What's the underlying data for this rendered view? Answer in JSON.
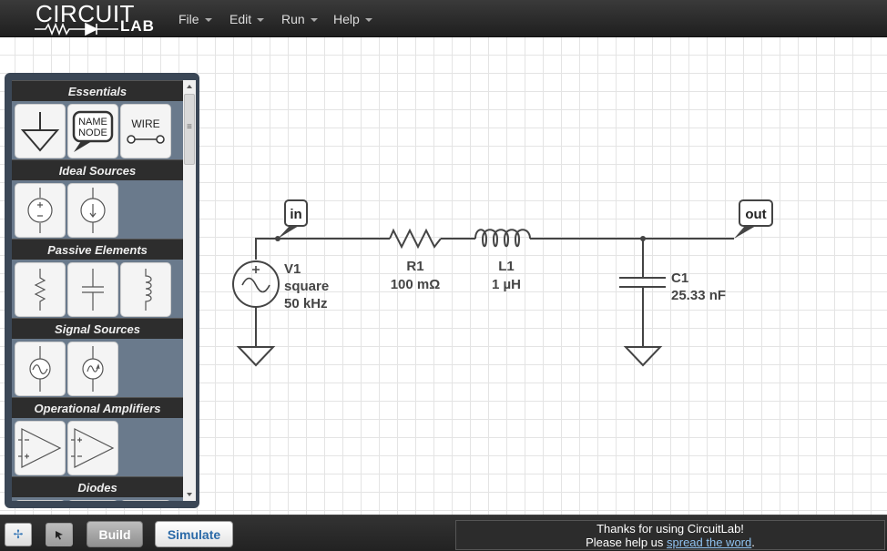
{
  "header": {
    "logo_top": "CIRCUIT",
    "logo_bottom": "LAB",
    "menus": [
      {
        "label": "File"
      },
      {
        "label": "Edit"
      },
      {
        "label": "Run"
      },
      {
        "label": "Help"
      }
    ]
  },
  "palette": {
    "categories": [
      {
        "name": "Essentials",
        "parts": [
          "ground",
          "name-node",
          "wire"
        ]
      },
      {
        "name": "Ideal Sources",
        "parts": [
          "dc-voltage-source",
          "dc-current-source"
        ]
      },
      {
        "name": "Passive Elements",
        "parts": [
          "resistor",
          "capacitor",
          "inductor"
        ]
      },
      {
        "name": "Signal Sources",
        "parts": [
          "ac-voltage-source",
          "ac-current-source"
        ]
      },
      {
        "name": "Operational Amplifiers",
        "parts": [
          "opamp-1",
          "opamp-2"
        ]
      },
      {
        "name": "Diodes",
        "parts": []
      }
    ],
    "name_node_label": "NAME\nNODE",
    "wire_label": "WIRE"
  },
  "schematic": {
    "node_in": "in",
    "node_out": "out",
    "v1": {
      "name": "V1",
      "type": "square",
      "freq": "50 kHz"
    },
    "r1": {
      "name": "R1",
      "value": "100 mΩ"
    },
    "l1": {
      "name": "L1",
      "value": "1 µH"
    },
    "c1": {
      "name": "C1",
      "value": "25.33 nF"
    }
  },
  "toolbar": {
    "build_label": "Build",
    "simulate_label": "Simulate"
  },
  "notice": {
    "line1": "Thanks for using CircuitLab!",
    "line2_prefix": "Please help us ",
    "link": "spread the word",
    "line2_suffix": "."
  }
}
